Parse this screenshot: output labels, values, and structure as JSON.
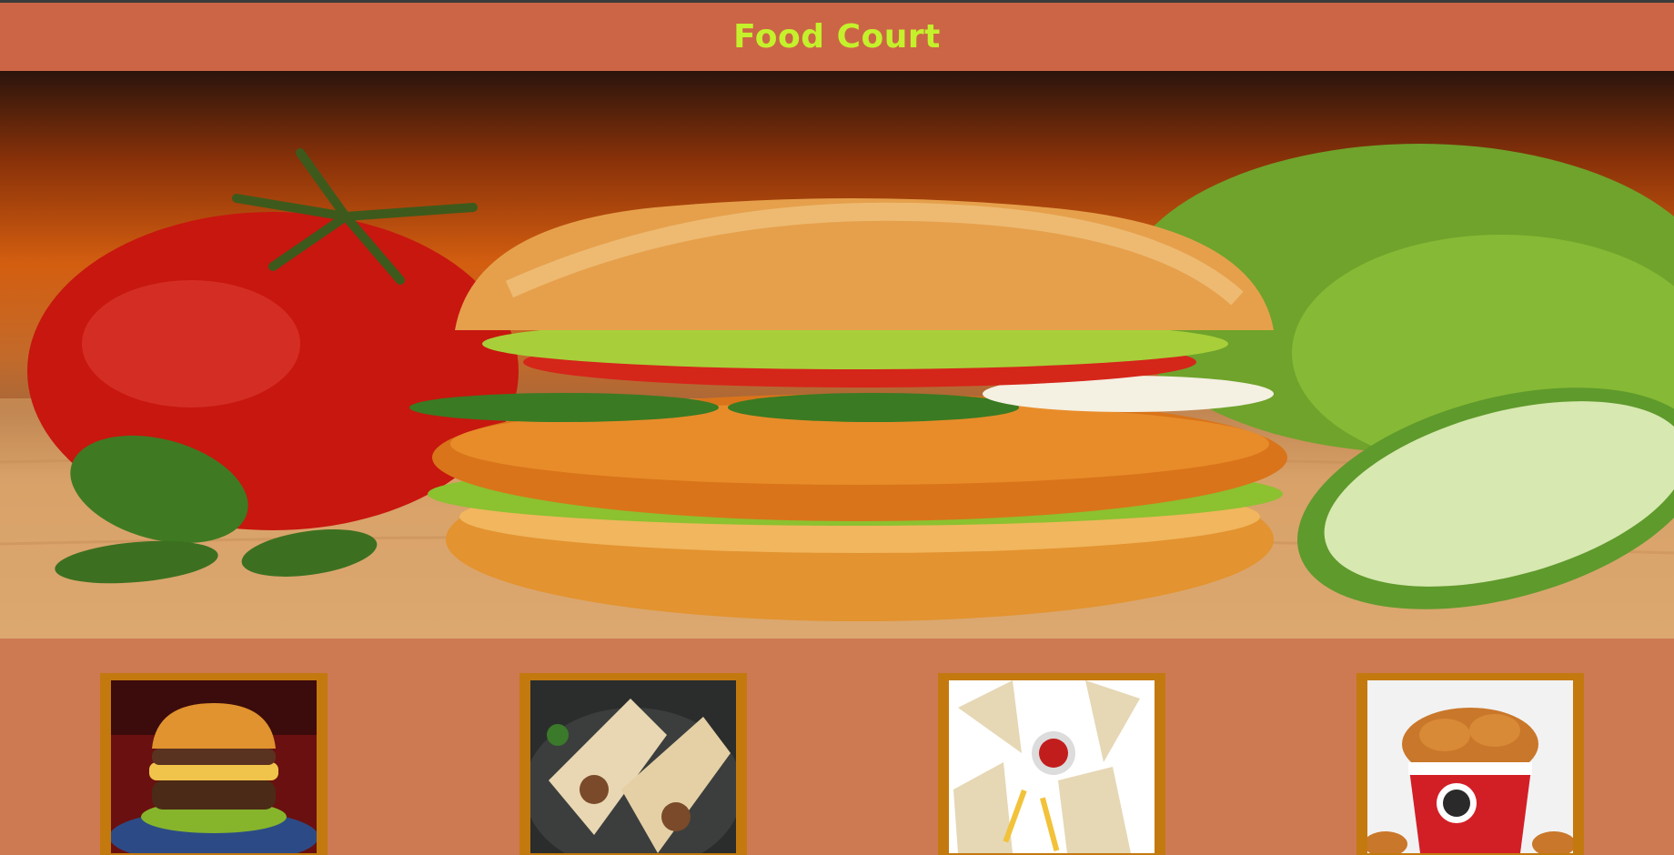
{
  "header": {
    "title": "Food Court"
  },
  "hero": {
    "image": "chicken-burger-with-tomato-lettuce-cucumber"
  },
  "cards": [
    {
      "image": "beef-burger"
    },
    {
      "image": "chicken-wraps"
    },
    {
      "image": "club-sandwiches-with-fries"
    },
    {
      "image": "fried-chicken-bucket"
    }
  ],
  "colors": {
    "header_bg": "#cc6546",
    "title": "#c4f12b",
    "page_bg": "#cd7a52",
    "card_frame": "#c4790f"
  }
}
